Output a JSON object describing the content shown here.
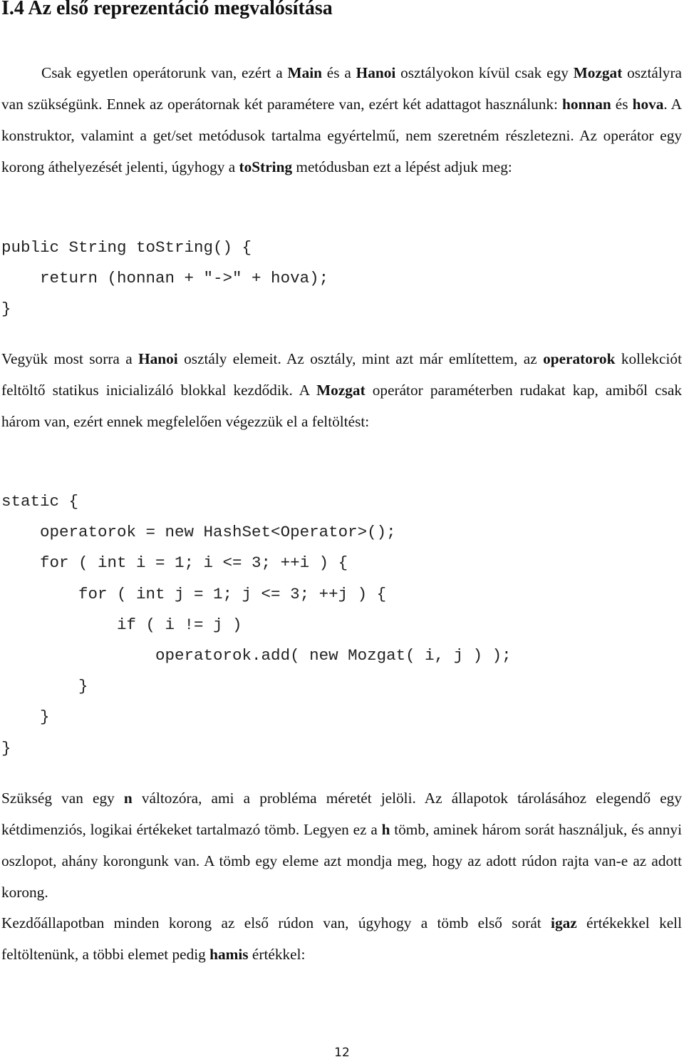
{
  "heading": "I.4 Az első reprezentáció megvalósítása",
  "paragraphs": [
    {
      "id": "p1",
      "segments": [
        {
          "text": "Csak egyetlen operátorunk van, ezért a ",
          "bold": false
        },
        {
          "text": "Main",
          "bold": true
        },
        {
          "text": " és a ",
          "bold": false
        },
        {
          "text": "Hanoi",
          "bold": true
        },
        {
          "text": " osztályokon kívül csak egy ",
          "bold": false
        },
        {
          "text": "Mozgat",
          "bold": true
        },
        {
          "text": " osztályra van szükségünk. Ennek az operátornak két paramétere van, ezért két adattagot használunk: ",
          "bold": false
        },
        {
          "text": "honnan",
          "bold": true
        },
        {
          "text": " és ",
          "bold": false
        },
        {
          "text": "hova",
          "bold": true
        },
        {
          "text": ". A konstruktor, valamint a get/set metódusok tartalma egyértelmű, nem szeretném részletezni. Az operátor egy korong áthelyezését jelenti, úgyhogy a ",
          "bold": false
        },
        {
          "text": "toString",
          "bold": true
        },
        {
          "text": " metódusban ezt a lépést adjuk meg:",
          "bold": false
        }
      ]
    },
    {
      "id": "p2",
      "segments": [
        {
          "text": "Vegyük most sorra a ",
          "bold": false
        },
        {
          "text": "Hanoi",
          "bold": true
        },
        {
          "text": " osztály elemeit. Az osztály, mint azt már említettem, az ",
          "bold": false
        },
        {
          "text": "operatorok",
          "bold": true
        },
        {
          "text": " kollekciót feltöltő statikus inicializáló blokkal kezdődik. A ",
          "bold": false
        },
        {
          "text": "Mozgat",
          "bold": true
        },
        {
          "text": " operátor paraméterben rudakat kap, amiből csak három van, ezért ennek megfelelően végezzük el a feltöltést:",
          "bold": false
        }
      ]
    },
    {
      "id": "p3",
      "segments": [
        {
          "text": "Szükség van egy ",
          "bold": false
        },
        {
          "text": "n",
          "bold": true
        },
        {
          "text": " változóra, ami a probléma méretét jelöli. Az állapotok tárolásához elegendő egy kétdimenziós, logikai értékeket tartalmazó tömb. Legyen ez a ",
          "bold": false
        },
        {
          "text": "h",
          "bold": true
        },
        {
          "text": " tömb, aminek három sorát használjuk, és annyi oszlopot, ahány korongunk van. A tömb egy eleme azt mondja meg, hogy az adott rúdon rajta van-e az adott korong.",
          "bold": false
        }
      ]
    },
    {
      "id": "p4",
      "segments": [
        {
          "text": "Kezdőállapotban minden korong az első rúdon van, úgyhogy a tömb első sorát ",
          "bold": false
        },
        {
          "text": "igaz",
          "bold": true
        },
        {
          "text": " értékekkel kell feltöltenünk, a többi elemet pedig ",
          "bold": false
        },
        {
          "text": "hamis",
          "bold": true
        },
        {
          "text": " értékkel:",
          "bold": false
        }
      ]
    }
  ],
  "code_blocks": [
    {
      "id": "code1",
      "lines": [
        "public String toString() {",
        "    return (honnan + \"->\" + hova);",
        "}"
      ]
    },
    {
      "id": "code2",
      "lines": [
        "static {",
        "    operatorok = new HashSet<Operator>();",
        "    for ( int i = 1; i <= 3; ++i ) {",
        "        for ( int j = 1; j <= 3; ++j ) {",
        "            if ( i != j )",
        "                operatorok.add( new Mozgat( i, j ) );",
        "        }",
        "    }",
        "}"
      ]
    }
  ],
  "page_number": "12"
}
